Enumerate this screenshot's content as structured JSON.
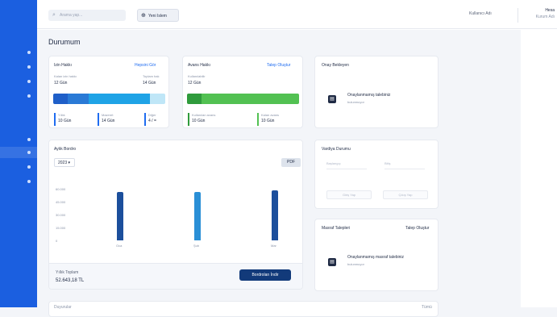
{
  "sidebar": {
    "items": [
      {
        "label": "",
        "active": false
      },
      {
        "label": "",
        "active": false
      },
      {
        "label": "",
        "active": false
      },
      {
        "label": "",
        "active": false
      },
      {
        "label": "",
        "active": false
      },
      {
        "label": "",
        "active": true
      },
      {
        "label": "",
        "active": false
      },
      {
        "label": "",
        "active": false
      }
    ]
  },
  "topbar": {
    "search_placeholder": "Arama yap...",
    "new_button_label": "Yeni Islem",
    "user_label": "Kullanıcı Adı",
    "account_line1": "Hesa",
    "account_line2": "Kurum Adı"
  },
  "page": {
    "title": "Durumum"
  },
  "card_a": {
    "title": "Izin Hakkı",
    "link": "Hepsini Gör",
    "left_caption": "Kalan izin hakkı",
    "left_value": "12 Gün",
    "right_caption": "Toplam hak",
    "right_value": "14 Gün",
    "bar_colors": [
      "#1f5fc8",
      "#2a7ad6",
      "#1fa3e6",
      "#bfe6f7"
    ],
    "legend": [
      {
        "caption": "Yıllık",
        "value": "10 Gün"
      },
      {
        "caption": "Mazeret",
        "value": "14 Gün"
      },
      {
        "caption": "Diğer",
        "value": "4 / ="
      }
    ]
  },
  "card_b": {
    "title": "Avans Hakkı",
    "link": "Talep Oluştur",
    "caption": "Kullanılabilir",
    "value": "12 Gün",
    "bar_colors": [
      "#2f9b3c",
      "#52c152"
    ],
    "legend": [
      {
        "caption": "Kullanılan avans",
        "value": "10 Gün"
      },
      {
        "caption": "Kalan avans",
        "value": "10 Gün"
      }
    ]
  },
  "card_c": {
    "title": "Onay Bekleyen",
    "item_title": "Onaylanmamış talebiniz",
    "item_sub": "bulunmuyor"
  },
  "card_d": {
    "title": "Aylık Bordro",
    "select_value": "2023",
    "chip_label": "PDF",
    "y_ticks": [
      "60.000",
      "45.000",
      "30.000",
      "15.000",
      "0"
    ],
    "footer_caption": "Yıllık Toplam",
    "footer_value": "52.643,18 TL",
    "button_label": "Bordroları İndir"
  },
  "chart_data": {
    "type": "bar",
    "categories": [
      "Oca",
      "Şub",
      "Mar"
    ],
    "values": [
      56000,
      56000,
      58000
    ],
    "ylim": [
      0,
      60000
    ],
    "colors": [
      "#1c4f9c",
      "#2a8fd6",
      "#1c4f9c"
    ]
  },
  "card_e": {
    "title": "Vardiya Durumu",
    "fields": [
      "Başlangıç",
      "Bitiş"
    ],
    "buttons": [
      "Giriş Yap",
      "Çıkış Yap"
    ]
  },
  "card_f": {
    "title": "Masraf Talepleri",
    "link": "Talep Oluştur",
    "item_title": "Onaylanmamış masraf talebiniz",
    "item_sub": "bulunmuyor"
  },
  "bottom_card": {
    "title": "Duyurular",
    "link": "Tümü"
  }
}
